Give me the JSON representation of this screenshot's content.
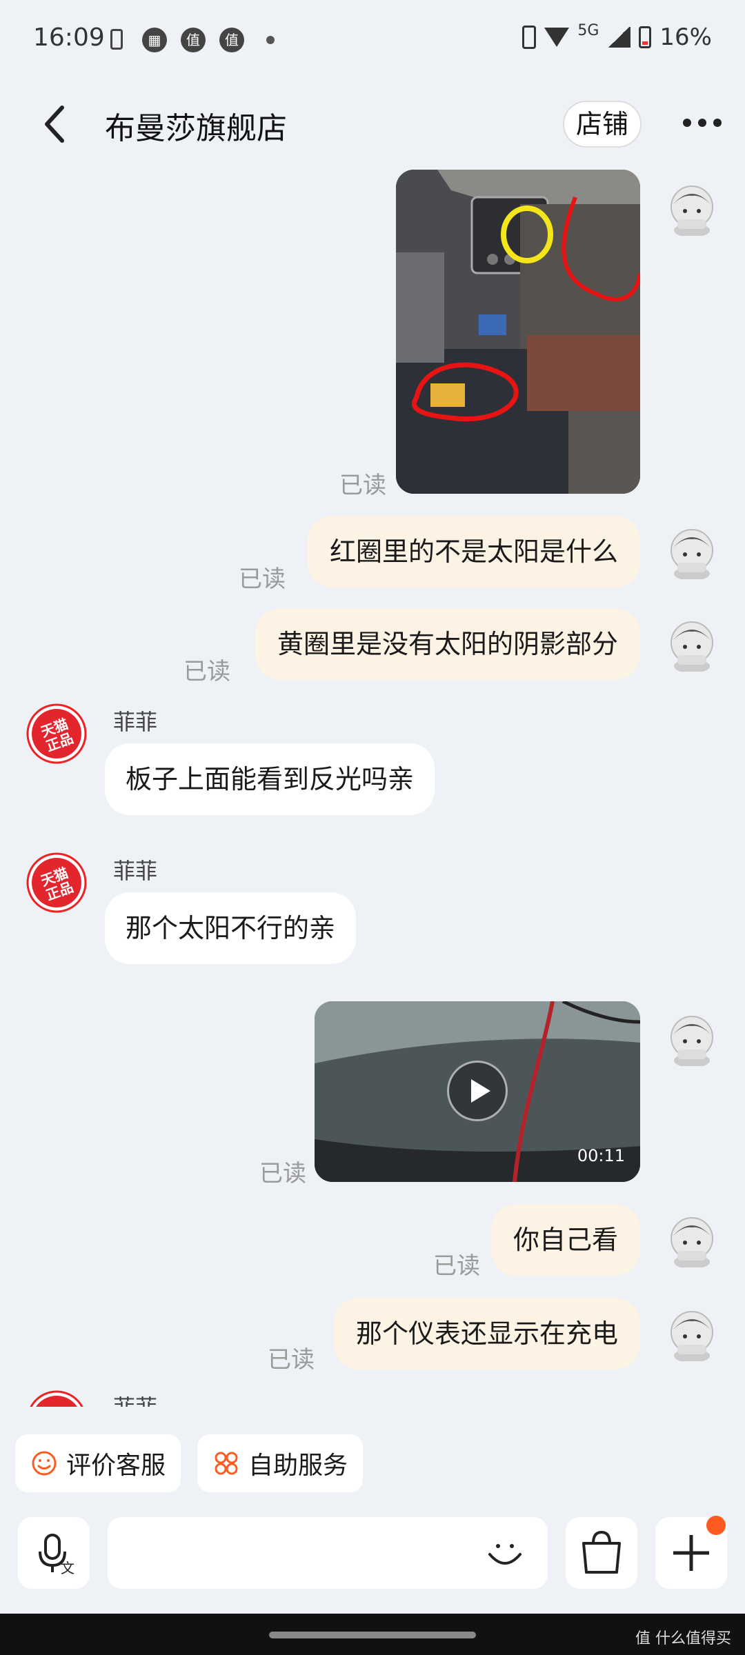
{
  "status_bar": {
    "time": "16:09",
    "network": "5G",
    "battery": "16%",
    "icons": [
      "battery-saver-icon",
      "calendar-icon",
      "zhi-app-icon",
      "zhi-app-icon",
      "dot-icon",
      "nfc-icon",
      "wifi-icon",
      "signal-icon",
      "battery-icon"
    ]
  },
  "header": {
    "title": "布曼莎旗舰店",
    "store_label": "店铺"
  },
  "messages": [
    {
      "type": "image",
      "from": "user",
      "read": "已读"
    },
    {
      "type": "text",
      "from": "user",
      "text": "红圈里的不是太阳是什么",
      "read": "已读"
    },
    {
      "type": "text",
      "from": "user",
      "text": "黄圈里是没有太阳的阴影部分",
      "read": "已读"
    },
    {
      "type": "text",
      "from": "shop",
      "sender": "菲菲",
      "text": "板子上面能看到反光吗亲"
    },
    {
      "type": "text",
      "from": "shop",
      "sender": "菲菲",
      "text": "那个太阳不行的亲"
    },
    {
      "type": "video",
      "from": "user",
      "duration": "00:11",
      "read": "已读"
    },
    {
      "type": "text",
      "from": "user",
      "text": "你自己看",
      "read": "已读"
    },
    {
      "type": "text",
      "from": "user",
      "text": "那个仪表还显示在充电",
      "read": "已读"
    },
    {
      "type": "text",
      "from": "shop",
      "sender": "菲菲"
    }
  ],
  "shop_avatar_text": [
    "天猫",
    "正品"
  ],
  "quick_actions": [
    {
      "label": "评价客服",
      "icon": "smile-icon"
    },
    {
      "label": "自助服务",
      "icon": "service-grid-icon"
    }
  ],
  "input_bar": {
    "voice_sub": "文"
  },
  "watermark": "值 什么值得买",
  "colors": {
    "accent": "#ff5a1f",
    "bubble_out": "#fdf3e5",
    "bubble_in": "#ffffff",
    "background": "#eef1f5"
  }
}
